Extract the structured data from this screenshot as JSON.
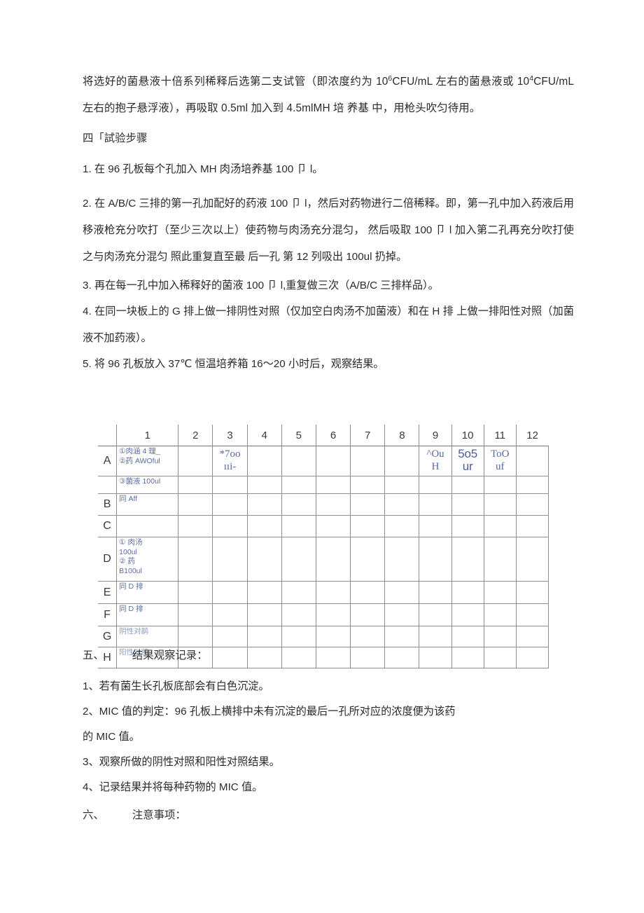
{
  "document": {
    "intro_paragraph": "将选好的菌悬液十倍系列稀释后选第二支试管（即浓度约为  10⁶CFU/mL 左右的菌悬液或 10⁴CFU/mL 左右的抱子悬浮液），再吸取 0.5ml 加入到 4.5mlMH 培 养基 中，用枪头吹匀待用。",
    "intro_line1_a": "将选好的菌悬液十倍系列稀释后选第二支试管（即浓度约为  10",
    "intro_line1_sup": "6",
    "intro_line1_b": "CFU/mL 左右的菌悬液",
    "intro_line2_a": "或 10",
    "intro_line2_sup": "4",
    "intro_line2_b": "CFU/mL 左右的抱子悬浮液），再吸取 0.5ml 加入到 4.5mlMH 培 养基 中，用枪",
    "intro_line3": "头吹匀待用。",
    "section_four_heading": "四「試验步骤",
    "steps": [
      "1. 在 96 孔板每个孔加入 MH 肉汤培养基 100 卩 l。",
      "2. 在 A/B/C 三排的第一孔加配好的药液 100 卩 l，然后对药物进行二倍稀释。即，第一孔中加入药液后用移液枪充分吹打（至少三次以上）使药物与肉汤充分混匀， 然后吸取 100 卩 l 加入第二孔再充分吹打使之与肉汤充分混匀 照此重复直至最 后一孔 第 12 列吸出 100ul 扔掉。",
      "3. 再在每一孔中加入稀释好的菌液 100 卩 l,重复做三次（A/B/C 三排样品）。",
      "4. 在同一块板上的 G 排上做一排阴性对照（仅加空白肉汤不加菌液）和在 H 排 上做一排阳性对照（加菌液不加药液）。",
      "5. 将 96 孔板放入 37℃ 恒温培养箱 16～20 小时后，观察结果。"
    ],
    "step2_lines": [
      "2. 在 A/B/C 三排的第一孔加配好的药液 100 卩 l，然后对药物进行二倍稀释。即，第一",
      "孔中加入药液后用移液枪充分吹打（至少三次以上）使药物与肉汤充分混匀， 然后吸",
      "取 100 卩 l 加入第二孔再充分吹打使之与肉汤充分混匀 照此重复直至最 后一孔 第 12",
      "列吸出 100ul 扔掉。"
    ],
    "step4_lines": [
      "4. 在同一块板上的 G 排上做一排阴性对照（仅加空白肉汤不加菌液）和在 H 排 上做一",
      "排阳性对照（加菌液不加药液）。"
    ],
    "section_five_number": "五、",
    "section_five_heading": "结果观察记录：",
    "results": [
      "1、若有菌生长孔板底部会有白色沉淀。",
      "2、MIC 值的判定：96 孔板上横排中未有沉淀的最后一孔所对应的浓度便为该药",
      "的 MIC 值。",
      "3、观察所做的阴性对照和阳性对照结果。",
      "4、记录结果并将每种药物的 MIC 值。"
    ],
    "section_six_number": "六、",
    "section_six_heading": "注意事项："
  },
  "plate_table": {
    "corner_label": "",
    "column_headers": [
      "1",
      "2",
      "3",
      "4",
      "5",
      "6",
      "7",
      "8",
      "9",
      "10",
      "11",
      "12"
    ],
    "row_labels": [
      "A",
      "",
      "B",
      "C",
      "D",
      "E",
      "F",
      "G",
      "H"
    ],
    "annotation_color": "#5c6ca6",
    "cells": {
      "A1_line1": "①肉涵 4 理_",
      "A1_line2": "②药 AWOful",
      "A3_line1": "*7oo",
      "A3_line2": "ııi-",
      "A9_line1": "^Ou",
      "A9_line2": "H",
      "A10_line1": "5o5",
      "A10_line2": "ur",
      "A11_line1": "ToO",
      "A11_line2": "uf",
      "A2row_1": "③菌液 100ul",
      "B1": "同 Aff",
      "C1": "",
      "D1_line1": "①      肉汤",
      "D1_line2": "100ul",
      "D1_line3": "②      药",
      "D1_line4": "B100ul",
      "E1": "同 D 排",
      "F1": "同 D 排",
      "G1": "阴性对鹋",
      "H1": "阳性对照"
    }
  }
}
